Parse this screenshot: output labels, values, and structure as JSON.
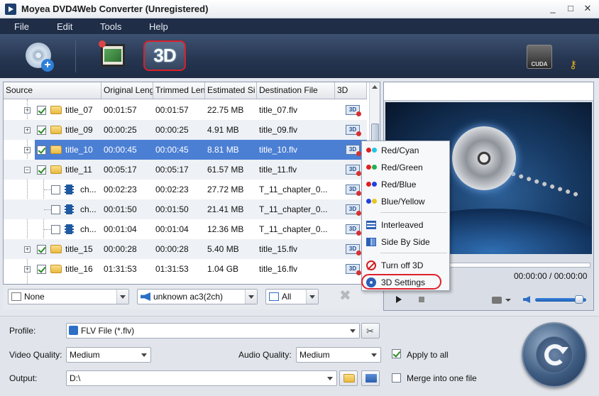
{
  "window": {
    "title": "Moyea DVD4Web Converter (Unregistered)",
    "min": "_",
    "max": "□",
    "close": "✕"
  },
  "menu": [
    "File",
    "Edit",
    "Tools",
    "Help"
  ],
  "toolbar": {
    "three_d_label": "3D",
    "cuda_label": "CUDA"
  },
  "list": {
    "headers": [
      "Source",
      "Original Leng",
      "Trimmed Len",
      "Estimated Si",
      "Destination File",
      "3D"
    ],
    "three_d_icon_label": "3D",
    "rows": [
      {
        "name": "title_07",
        "orig": "00:01:57",
        "trim": "00:01:57",
        "size": "22.75 MB",
        "dest": "title_07.flv",
        "checked": true,
        "kind": "title"
      },
      {
        "name": "title_09",
        "orig": "00:00:25",
        "trim": "00:00:25",
        "size": "4.91 MB",
        "dest": "title_09.flv",
        "checked": true,
        "kind": "title"
      },
      {
        "name": "title_10",
        "orig": "00:00:45",
        "trim": "00:00:45",
        "size": "8.81 MB",
        "dest": "title_10.flv",
        "checked": true,
        "kind": "title",
        "selected": true
      },
      {
        "name": "title_11",
        "orig": "00:05:17",
        "trim": "00:05:17",
        "size": "61.57 MB",
        "dest": "title_11.flv",
        "checked": true,
        "kind": "title",
        "expanded": true
      },
      {
        "name": "ch...",
        "orig": "00:02:23",
        "trim": "00:02:23",
        "size": "27.72 MB",
        "dest": "T_11_chapter_0...",
        "checked": false,
        "kind": "chapter"
      },
      {
        "name": "ch...",
        "orig": "00:01:50",
        "trim": "00:01:50",
        "size": "21.41 MB",
        "dest": "T_11_chapter_0...",
        "checked": false,
        "kind": "chapter"
      },
      {
        "name": "ch...",
        "orig": "00:01:04",
        "trim": "00:01:04",
        "size": "12.36 MB",
        "dest": "T_11_chapter_0...",
        "checked": false,
        "kind": "chapter"
      },
      {
        "name": "title_15",
        "orig": "00:00:28",
        "trim": "00:00:28",
        "size": "5.40 MB",
        "dest": "title_15.flv",
        "checked": true,
        "kind": "title"
      },
      {
        "name": "title_16",
        "orig": "01:31:53",
        "trim": "01:31:53",
        "size": "1.04 GB",
        "dest": "title_16.flv",
        "checked": true,
        "kind": "title"
      }
    ]
  },
  "bottom_bar": {
    "subtitle": "None",
    "audio": "unknown ac3(2ch)",
    "angle": "All"
  },
  "context_menu": {
    "items": [
      "Red/Cyan",
      "Red/Green",
      "Red/Blue",
      "Blue/Yellow",
      "Interleaved",
      "Side By Side",
      "Turn off 3D",
      "3D Settings"
    ]
  },
  "preview": {
    "time": "00:00:00 / 00:00:00"
  },
  "settings": {
    "profile_label": "Profile:",
    "profile_value": "FLV File (*.flv)",
    "video_quality_label": "Video Quality:",
    "video_quality_value": "Medium",
    "audio_quality_label": "Audio Quality:",
    "audio_quality_value": "Medium",
    "apply_to_all": "Apply to all",
    "output_label": "Output:",
    "output_value": "D:\\",
    "merge_label": "Merge into one file"
  },
  "colors": {
    "menubar": "#1f2d47",
    "toolbar": "#253550",
    "selection": "#4b7fd4",
    "highlight_ring": "#e0202a"
  }
}
